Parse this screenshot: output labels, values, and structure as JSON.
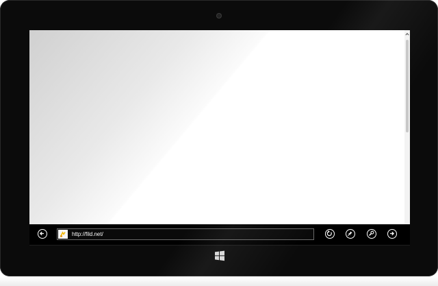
{
  "browser": {
    "address_bar": {
      "url": "http://fild.net/"
    },
    "buttons": {
      "back": "back-arrow-icon",
      "refresh": "refresh-icon",
      "pin": "pin-icon",
      "tools": "wrench-icon",
      "forward": "forward-arrow-icon"
    }
  },
  "device": {
    "start_button": "windows-logo-icon"
  },
  "colors": {
    "bezel": "#0b0b0b",
    "appbar": "#000000",
    "favicon_accent": "#f2b705"
  }
}
